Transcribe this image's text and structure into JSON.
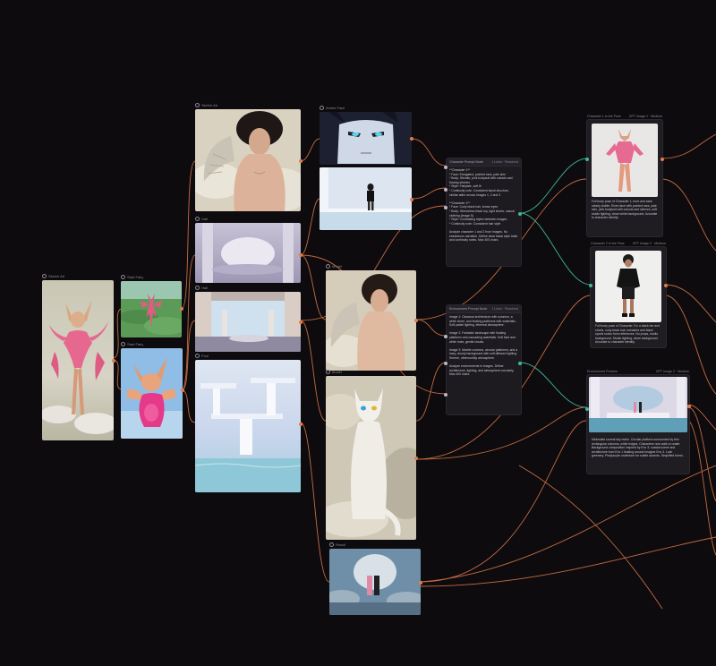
{
  "canvas": {
    "background": "#0d0b0e",
    "wire_color": "#e37b4c",
    "link_color": "#3fb89b"
  },
  "nodes": {
    "sketch_fairy": {
      "label": "Sketch Art"
    },
    "fairy_green": {
      "label": "Start Fairy"
    },
    "fairy_cat": {
      "label": "Start Fairy"
    },
    "angel": {
      "label": "Sketch Art"
    },
    "anime_face": {
      "label": "Anime Face"
    },
    "pool_figure": {
      "label": "Scene"
    },
    "hall": {
      "label": "Hall"
    },
    "hall2": {
      "label": "Hall"
    },
    "waterfall": {
      "label": "Pool"
    },
    "angel2": {
      "label": "Model"
    },
    "cat": {
      "label": "Model"
    },
    "couple": {
      "label": "Result"
    }
  },
  "prompt_character": {
    "title": "Character Prompt Node",
    "meta": "1 Links  ·  Resolved",
    "body": "**Character 1**\n* Face: Elongated, pointed ears, pale skin\n* Body: Slender, pink bodysuit with cutouts and flowing sleeves\n* Style: Fairytale, soft lit\n* Continuity note: Consistent facial structure, similar attire across images 1, 2 and 3\n\n**Character 2**\n* Face: Curly black hair, brown eyes\n* Body: Sleeveless black top, light shorts, casual clothing (image 5)\n* Style: Contrasting styles between images\n* Continuity note: Consistent hair style\n\nAnalyze character 1 and 2 from images. No extraneous narration. Define clear facial style traits and continuity notes. Max 400 chars."
  },
  "prompt_scene": {
    "title": "Environment Prompt Node",
    "meta": "1 Links  ·  Resolved",
    "body": "Image 1: Classical architecture with columns, a white stone, and floating platforms with waterfalls. Soft pastel lighting, ethereal atmosphere.\n\nImage 2: Fantastic landscape with floating platforms and cascading waterfalls. Soft blue and white hues, gentle clouds.\n\nImage 3: Marble columns, circular platforms, and a hazy, cloudy background with soft diffused lighting. Serene, otherworldly atmosphere.\n\nAnalyze environments in images. Define architecture, lighting, and atmosphere concisely. Max 400 chars."
  },
  "outputs": {
    "character1": {
      "title": "Character 1 in the Pose",
      "meta": "GPT Image 2  ·  Medium",
      "body": "Full body pose of Character 1, front and back clearly visible. Elven face with pointed ears, pale skin, pink bodysuit with cutouts and sleeves, soft studio lighting, clean white background. Accurate to character identity."
    },
    "character2": {
      "title": "Character 2 in the Pose",
      "meta": "GPT Image 2  ·  Medium",
      "body": "Full body pose of Character 2 in a black tee and shorts, curly black hair, sneakers and black sports socks from references. No props, studio background. Studio lighting, clean background. Accurate to character identity."
    },
    "environment": {
      "title": "Environment Preview",
      "meta": "GPT Image 2  ·  Medium",
      "body": "Minimalist surreal sky realm. Circular platform surrounded by thin rectangular columns, white ledges. Characters now walk on water. Background composition inspired by Env 3; coastal scene and architecture from Env 1 floating around Imagine Env 3. Lush greenery. Pink/purple undertone for subtle accents. Simplified forms."
    }
  }
}
